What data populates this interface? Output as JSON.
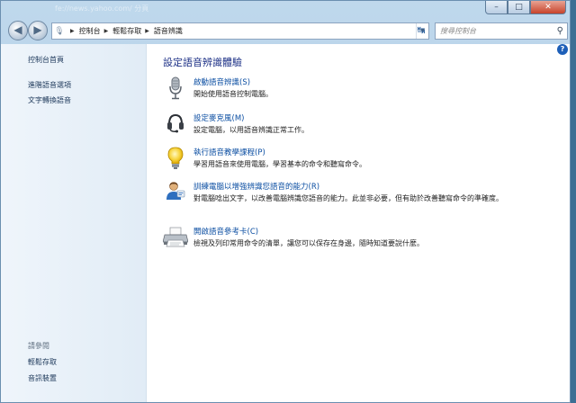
{
  "window": {
    "title_ghost": "fe://news.yahoo.com/ 分頁",
    "controls": {
      "minimize": "–",
      "maximize": "□",
      "close": "✕"
    }
  },
  "nav": {
    "back_glyph": "◀",
    "forward_glyph": "▶",
    "breadcrumbs": [
      "控制台",
      "輕鬆存取",
      "語音辨識"
    ],
    "search_placeholder": "搜尋控制台"
  },
  "sidebar": {
    "home": "控制台首頁",
    "links": [
      "進階語音選項",
      "文字轉換語音"
    ],
    "see_also_label": "請參閱",
    "see_also": [
      "輕鬆存取",
      "音訊裝置"
    ]
  },
  "main": {
    "title": "設定語音辨識體驗",
    "help_glyph": "?",
    "tasks": [
      {
        "icon": "microphone-icon",
        "link": "啟動語音辨識(S)",
        "desc": "開始使用語音控制電腦。"
      },
      {
        "icon": "headset-icon",
        "link": "設定麥克風(M)",
        "desc": "設定電腦，以用語音辨識正常工作。"
      },
      {
        "icon": "lightbulb-icon",
        "link": "執行語音教學課程(P)",
        "desc": "學習用語音來使用電腦，學習基本的命令和聽寫命令。"
      },
      {
        "icon": "user-training-icon",
        "link": "訓練電腦以增強辨識您語音的能力(R)",
        "desc": "對電腦唸出文字，以改善電腦辨識您語音的能力。此並非必要，但有助於改善聽寫命令的準確度。"
      },
      {
        "icon": "printer-icon",
        "link": "開啟語音參考卡(C)",
        "desc": "檢視及列印常用命令的清單，讓您可以保存在身邊，隨時知道要說什麼。"
      }
    ]
  }
}
